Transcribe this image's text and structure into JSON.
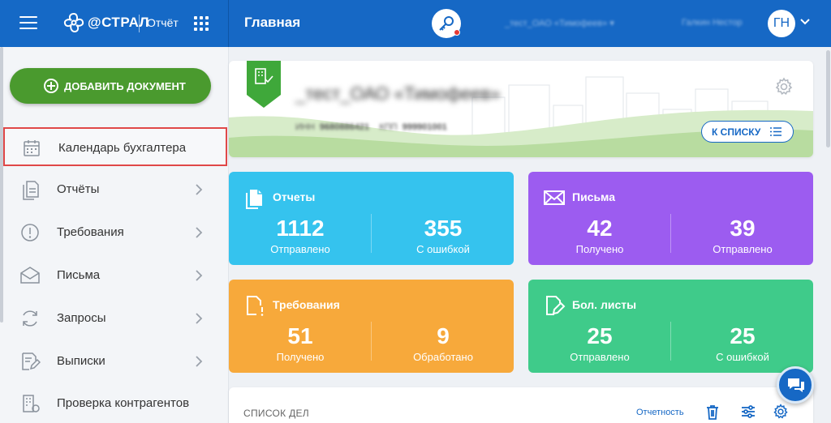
{
  "header": {
    "brand": "@СТРАЛ",
    "product": "Отчёт",
    "page_title": "Главная",
    "organization": "_тест_ОАО «Тимофеев»",
    "user_name": "Галкин Нестор",
    "user_initials": "ГН",
    "colors": {
      "header_bg": "#1668c5"
    }
  },
  "sidebar": {
    "add_button": "ДОБАВИТЬ ДОКУМЕНТ",
    "items": [
      {
        "label": "Календарь бухгалтера",
        "icon": "calendar-icon",
        "active": true
      },
      {
        "label": "Отчёты",
        "icon": "reports-icon"
      },
      {
        "label": "Требования",
        "icon": "alert-circle-icon"
      },
      {
        "label": "Письма",
        "icon": "envelope-icon"
      },
      {
        "label": "Запросы",
        "icon": "refresh-icon"
      },
      {
        "label": "Выписки",
        "icon": "edit-document-icon"
      },
      {
        "label": "Проверка контрагентов",
        "icon": "building-check-icon"
      }
    ]
  },
  "org_card": {
    "name": "_тест_ОАО «Тимофеев»",
    "inn_label": "ИНН",
    "inn": "9680886421",
    "kpp_label": "КПП",
    "kpp": "999901001",
    "to_list_button": "К СПИСКУ"
  },
  "tiles": [
    {
      "title": "Отчеты",
      "color": "#35c3ee",
      "icon": "documents-icon",
      "v1": "1112",
      "l1": "Отправлено",
      "v2": "355",
      "l2": "С ошибкой"
    },
    {
      "title": "Письма",
      "color": "#9c5cf0",
      "icon": "envelope-icon",
      "v1": "42",
      "l1": "Получено",
      "v2": "39",
      "l2": "Отправлено"
    },
    {
      "title": "Требования",
      "color": "#f7a93b",
      "icon": "document-alert-icon",
      "v1": "51",
      "l1": "Получено",
      "v2": "9",
      "l2": "Обработано"
    },
    {
      "title": "Бол. листы",
      "color": "#3fcb8a",
      "icon": "document-edit-icon",
      "v1": "25",
      "l1": "Отправлено",
      "v2": "25",
      "l2": "С ошибкой"
    }
  ],
  "todo": {
    "title": "СПИСОК ДЕЛ",
    "filter_link": "Отчетность"
  }
}
